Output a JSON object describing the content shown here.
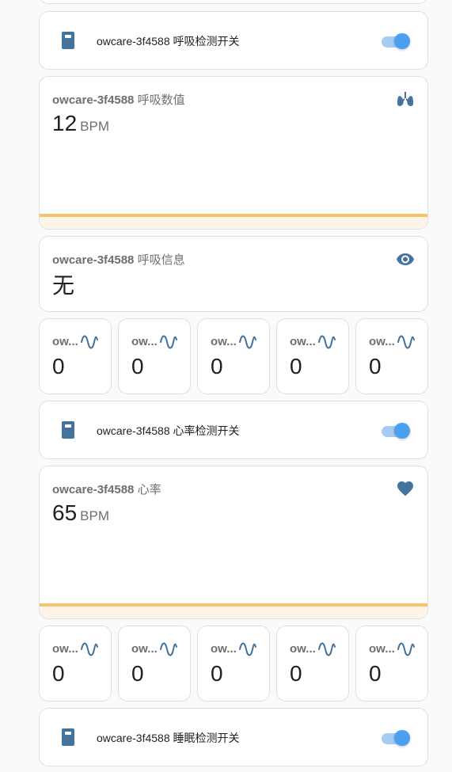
{
  "colors": {
    "icon": "#44739e",
    "switch_knob": "#4a9ff0",
    "switch_track": "#a7ccf3",
    "graph_line": "#f2c46e",
    "graph_fill": "#fdf3e6"
  },
  "cards": {
    "breath_switch": {
      "device": "owcare-3f4588",
      "label": "呼吸检测开关",
      "icon": "device-icon",
      "state": "on"
    },
    "breath_value": {
      "device": "owcare-3f4588",
      "label": "呼吸数值",
      "value": "12",
      "unit": "BPM",
      "icon": "lungs-icon"
    },
    "breath_info": {
      "device": "owcare-3f4588",
      "label": "呼吸信息",
      "value": "无",
      "icon": "eye-icon"
    },
    "breath_sensors": [
      {
        "name": "ow...",
        "value": "0",
        "icon": "sine-wave-icon"
      },
      {
        "name": "ow...",
        "value": "0",
        "icon": "sine-wave-icon"
      },
      {
        "name": "ow...",
        "value": "0",
        "icon": "sine-wave-icon"
      },
      {
        "name": "ow...",
        "value": "0",
        "icon": "sine-wave-icon"
      },
      {
        "name": "ow...",
        "value": "0",
        "icon": "sine-wave-icon"
      }
    ],
    "heart_switch": {
      "device": "owcare-3f4588",
      "label": "心率检测开关",
      "icon": "device-icon",
      "state": "on"
    },
    "heart_value": {
      "device": "owcare-3f4588",
      "label": "心率",
      "value": "65",
      "unit": "BPM",
      "icon": "heart-icon"
    },
    "heart_sensors": [
      {
        "name": "ow...",
        "value": "0",
        "icon": "sine-wave-icon"
      },
      {
        "name": "ow...",
        "value": "0",
        "icon": "sine-wave-icon"
      },
      {
        "name": "ow...",
        "value": "0",
        "icon": "sine-wave-icon"
      },
      {
        "name": "ow...",
        "value": "0",
        "icon": "sine-wave-icon"
      },
      {
        "name": "ow...",
        "value": "0",
        "icon": "sine-wave-icon"
      }
    ],
    "sleep_switch": {
      "device": "owcare-3f4588",
      "label": "睡眠检测开关",
      "icon": "device-icon",
      "state": "on"
    }
  }
}
